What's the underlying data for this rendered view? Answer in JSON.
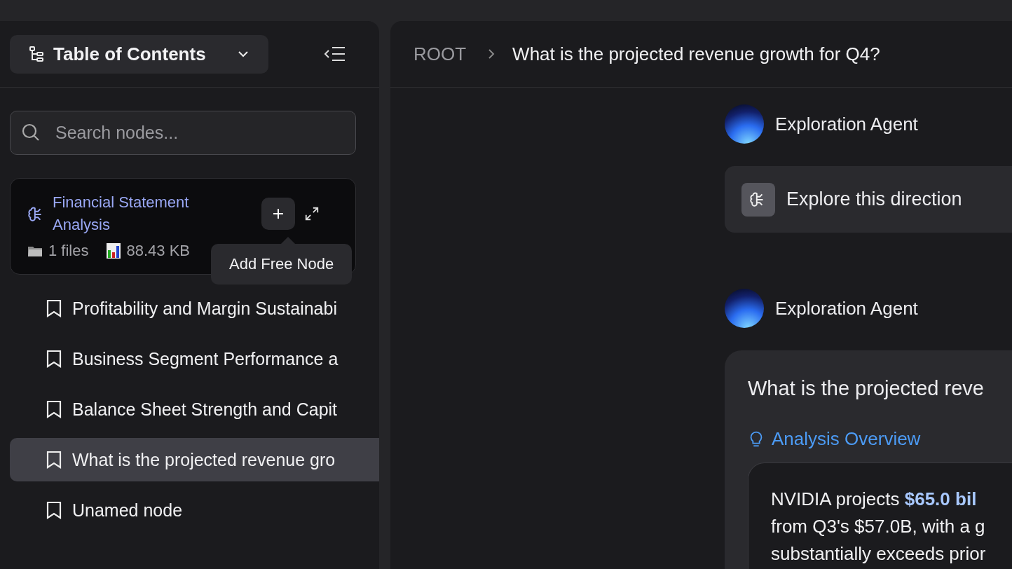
{
  "sidebar": {
    "toc_button": "Table of Contents",
    "search": {
      "placeholder": "Search nodes..."
    },
    "project": {
      "title": "Financial Statement Analysis",
      "files": "1 files",
      "size": "88.43 KB",
      "tooltip": "Add Free Node"
    },
    "items": [
      {
        "label": "Profitability and Margin Sustainabi",
        "selected": false
      },
      {
        "label": "Business Segment Performance a",
        "selected": false
      },
      {
        "label": "Balance Sheet Strength and Capit",
        "selected": false
      },
      {
        "label": "What is the projected revenue gro",
        "selected": true
      },
      {
        "label": "Unamed node",
        "selected": false
      }
    ]
  },
  "breadcrumb": [
    "ROOT",
    "What is the projected revenue growth for Q4?"
  ],
  "messages": [
    {
      "kind": "action",
      "author": "Exploration Agent",
      "text": "Explore this direction"
    },
    {
      "kind": "answer",
      "author": "Exploration Agent",
      "title": "What is the projected reve",
      "section": "Analysis Overview",
      "lines": [
        "NVIDIA projects **$65.0 bil**",
        "from Q3's $57.0B, with a g",
        "substantially exceeds prior"
      ]
    }
  ]
}
